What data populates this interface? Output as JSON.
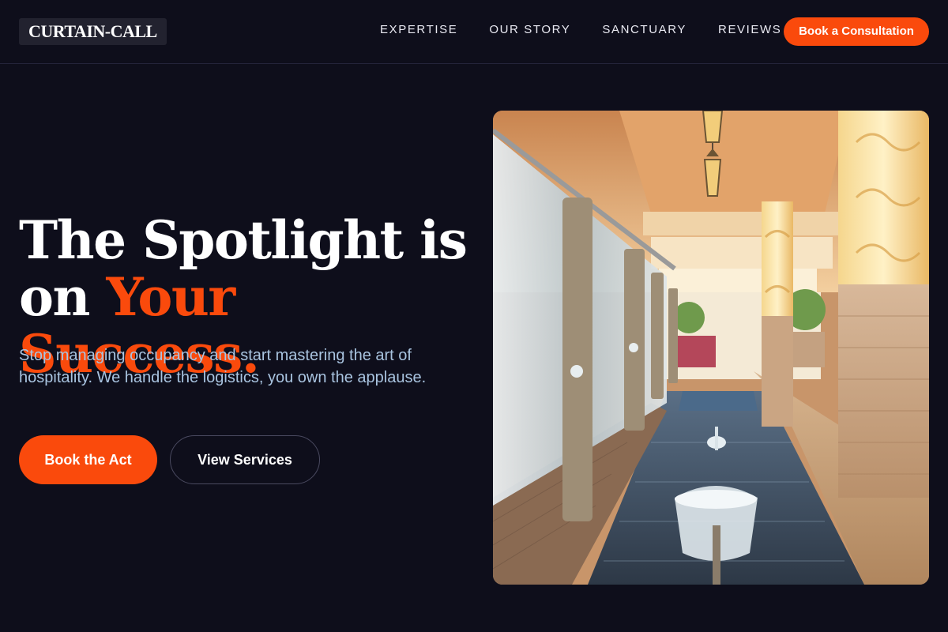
{
  "header": {
    "logo": "CURTAIN-CALL",
    "nav": [
      "EXPERTISE",
      "OUR STORY",
      "SANCTUARY",
      "REVIEWS"
    ],
    "cta_label": "Book a Consultation"
  },
  "hero": {
    "headline_line1": "The Spotlight is",
    "headline_line2_plain": "on ",
    "headline_line2_accent": "Your Success.",
    "subtext": "Stop managing occupancy and start mastering the art of hospitality. We handle the logistics, you own the applause.",
    "primary_label": "Book the Act",
    "secondary_label": "View Services",
    "image_subject": "hotel-courtyard-fountain-photo"
  },
  "colors": {
    "background": "#0e0e1b",
    "accent": "#fa4a0c",
    "subtext": "#a9c4e0"
  }
}
